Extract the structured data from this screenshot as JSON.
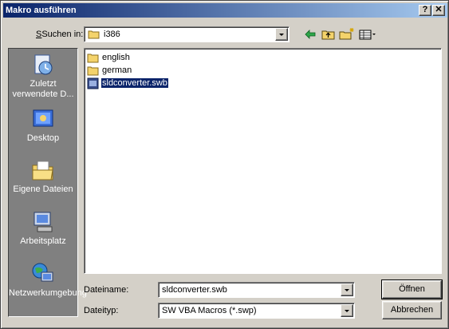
{
  "window": {
    "title": "Makro ausführen",
    "help_label": "?",
    "close_label": "✕"
  },
  "lookin": {
    "label": "Suchen in:",
    "value": "i386"
  },
  "toolbar": {
    "icons": [
      "back-icon",
      "up-folder-icon",
      "new-folder-icon",
      "view-menu-icon"
    ]
  },
  "places": [
    {
      "label": "Zuletzt verwendete D...",
      "icon": "recent-documents-icon"
    },
    {
      "label": "Desktop",
      "icon": "desktop-icon"
    },
    {
      "label": "Eigene Dateien",
      "icon": "my-documents-icon"
    },
    {
      "label": "Arbeitsplatz",
      "icon": "my-computer-icon"
    },
    {
      "label": "Netzwerkumgebung",
      "icon": "network-icon"
    }
  ],
  "files": [
    {
      "name": "english",
      "type": "folder"
    },
    {
      "name": "german",
      "type": "folder"
    },
    {
      "name": "sldconverter.swb",
      "type": "file",
      "selected": true
    }
  ],
  "filename": {
    "label": "Dateiname:",
    "value": "sldconverter.swb"
  },
  "filetype": {
    "label": "Dateityp:",
    "value": "SW VBA Macros (*.swp)"
  },
  "buttons": {
    "open": "Öffnen",
    "cancel": "Abbrechen"
  },
  "colors": {
    "title_start": "#0a246a",
    "title_end": "#a6caf0",
    "face": "#d4d0c8",
    "places_bg": "#808080",
    "selection": "#0a246a"
  }
}
